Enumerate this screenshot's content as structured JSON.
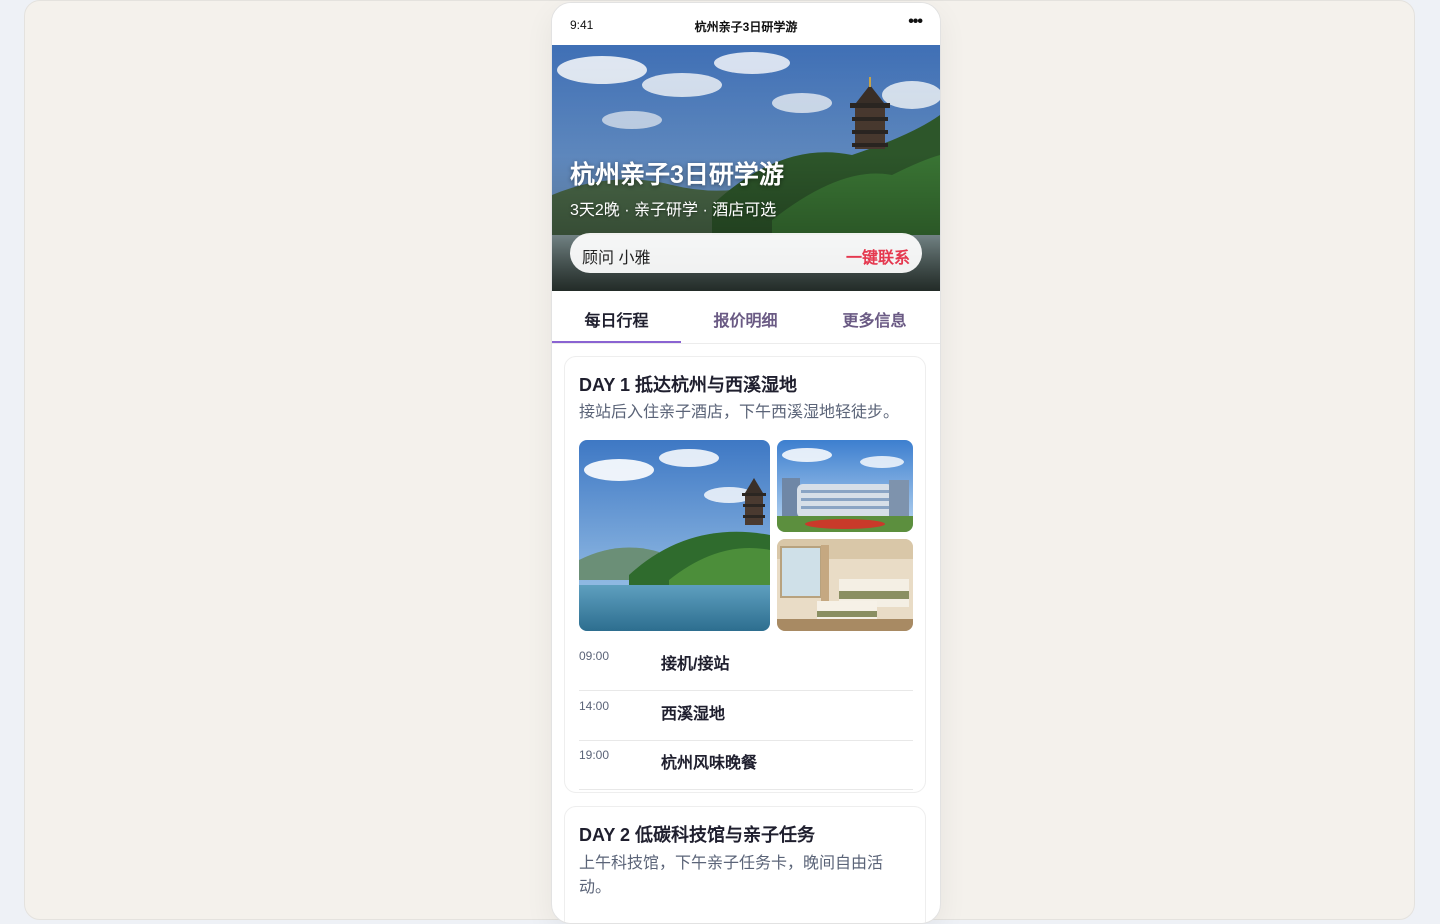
{
  "statusbar": {
    "time": "9:41",
    "title": "杭州亲子3日研学游",
    "more": "•••"
  },
  "hero": {
    "title": "杭州亲子3日研学游",
    "subtitle": "3天2晚 · 亲子研学 · 酒店可选",
    "advisor": "顾问 小雅",
    "contact": "一键联系"
  },
  "tabs": [
    "每日行程",
    "报价明细",
    "更多信息"
  ],
  "days": [
    {
      "title": "DAY 1 抵达杭州与西溪湿地",
      "desc": "接站后入住亲子酒店，下午西溪湿地轻徒步。",
      "schedule": [
        {
          "time": "09:00",
          "name": "接机/接站"
        },
        {
          "time": "14:00",
          "name": "西溪湿地"
        },
        {
          "time": "19:00",
          "name": "杭州风味晚餐"
        }
      ]
    },
    {
      "title": "DAY 2 低碳科技馆与亲子任务",
      "desc": "上午科技馆，下午亲子任务卡，晚间自由活动。"
    }
  ],
  "colors": {
    "accent": "#8a63d2",
    "contact": "#e5384f"
  }
}
